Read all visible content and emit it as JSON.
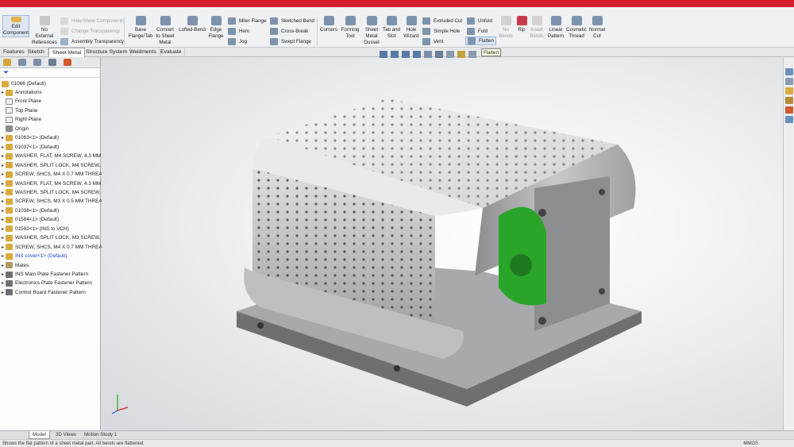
{
  "ribbon": {
    "edit_component": "Edit Component",
    "no_external_refs": "No External References",
    "hide_show_components": "Hide/Show Components",
    "change_transparency": "Change Transparency",
    "assembly_transparency": "Assembly Transparency",
    "base_flange": "Base Flange/Tab",
    "convert_sheet_metal": "Convert to Sheet Metal",
    "lofted_bend": "Lofted-Bend",
    "edge_flange": "Edge Flange",
    "miter_flange": "Miter Flange",
    "hem": "Hem",
    "jog": "Jog",
    "sketched_bend": "Sketched Bend",
    "cross_break": "Cross-Break",
    "swept_flange": "Swept Flange",
    "corners": "Corners",
    "forming_tool": "Forming Tool",
    "sheet_metal_gusset": "Sheet Metal Gusset",
    "tab_and_slot": "Tab and Slot",
    "hole_wizard": "Hole Wizard",
    "extruded_cut": "Extruded Cut",
    "simple_hole": "Simple Hole",
    "vent": "Vent",
    "unfold": "Unfold",
    "fold": "Fold",
    "flatten": "Flatten",
    "no_bends": "No Bends",
    "rip": "Rip",
    "insert_bends": "Insert Bends",
    "linear_pattern": "Linear Pattern",
    "cosmetic_thread": "Cosmetic Thread",
    "normal_cut": "Normal Cut"
  },
  "tooltip": "Flatten",
  "command_tabs": [
    "Features",
    "Sketch",
    "Sheet Metal",
    "Structure System",
    "Weldments",
    "Evaluate"
  ],
  "tree": {
    "root": "01066  (Default)",
    "items": [
      {
        "label": "Annotations",
        "icon": "annotations-icon"
      },
      {
        "label": "Front Plane",
        "icon": "plane-icon"
      },
      {
        "label": "Top Plane",
        "icon": "plane-icon"
      },
      {
        "label": "Right Plane",
        "icon": "plane-icon"
      },
      {
        "label": "Origin",
        "icon": "origin-icon"
      },
      {
        "label": "01063<1> (Default)",
        "icon": "part-icon"
      },
      {
        "label": "01037<1> (Default)",
        "icon": "part-icon"
      },
      {
        "label": "WASHER, FLAT, M4 SCREW, 4.3 MM",
        "icon": "part-icon"
      },
      {
        "label": "WASHER, SPLIT LOCK, M4 SCREW, 4",
        "icon": "part-icon"
      },
      {
        "label": "SCREW, SHCS, M4 X 0.7 MM THREA",
        "icon": "part-icon"
      },
      {
        "label": "WASHER, FLAT, M4 SCREW, 4.3 MM",
        "icon": "part-icon"
      },
      {
        "label": "WASHER, SPLIT LOCK, M4 SCREW, 4",
        "icon": "part-icon"
      },
      {
        "label": "SCREW, SHCS, M3 X 0.5 MM THREA",
        "icon": "part-icon"
      },
      {
        "label": "01038<1> (Default)",
        "icon": "part-icon"
      },
      {
        "label": "01584<1> (Default)",
        "icon": "part-icon"
      },
      {
        "label": "01592<1> (INS to VCH)",
        "icon": "part-icon"
      },
      {
        "label": "WASHER, SPLIT LOCK, M3 SCREW, 3.",
        "icon": "part-icon"
      },
      {
        "label": "SCREW, SHCS, M4 X 0.7 MM THREA",
        "icon": "part-icon"
      },
      {
        "label": "INS cover<1> (Default)",
        "icon": "part-icon",
        "highlight": true
      },
      {
        "label": "Mates",
        "icon": "mates-icon"
      },
      {
        "label": "INS Main Plate Fastener Pattern",
        "icon": "pattern-icon"
      },
      {
        "label": "Electronics Plate Fastener Pattern",
        "icon": "pattern-icon"
      },
      {
        "label": "Control Board Fastener Pattern",
        "icon": "pattern-icon"
      }
    ]
  },
  "bottom_tabs": [
    "Model",
    "3D Views",
    "Motion Study 1"
  ],
  "status": {
    "message": "Shows the flat pattern of a sheet metal part. All bends are flattened.",
    "units": "MMGS"
  },
  "colors": {
    "brand_red": "#d4202c",
    "highlight_blue": "#1e3fc4",
    "pcb_green": "#2aa52a"
  }
}
